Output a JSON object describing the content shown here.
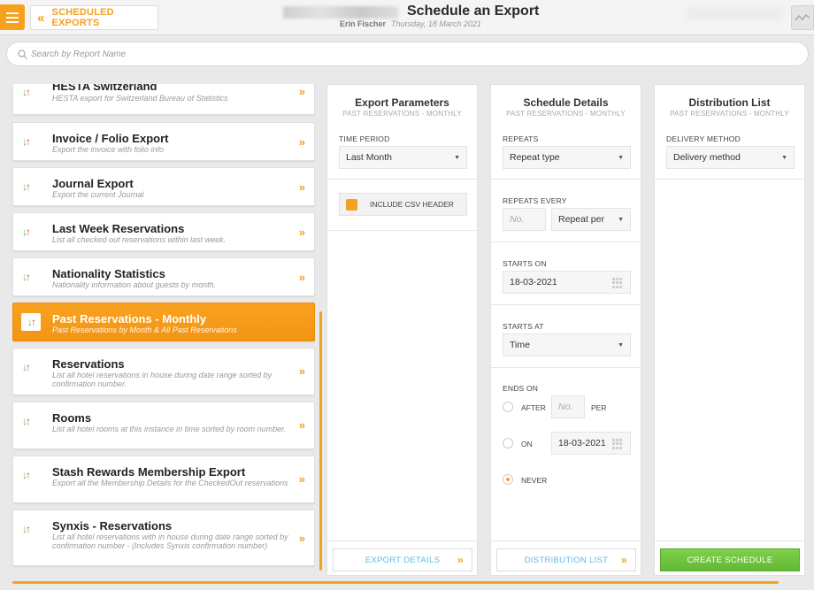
{
  "header": {
    "back_label": "SCHEDULED EXPORTS",
    "title": "Schedule an Export",
    "user": "Erin Fischer",
    "date": "Thursday, 18 March 2021"
  },
  "search": {
    "placeholder": "Search by Report Name"
  },
  "reports": [
    {
      "title": "HESTA Switzerland",
      "desc": "HESTA export for Switzerland Bureau of Statistics"
    },
    {
      "title": "Invoice / Folio Export",
      "desc": "Export the invoice with folio info"
    },
    {
      "title": "Journal Export",
      "desc": "Export the current Journal"
    },
    {
      "title": "Last Week Reservations",
      "desc": "List all checked out reservations within last week."
    },
    {
      "title": "Nationality Statistics",
      "desc": "Nationality information about guests by month."
    },
    {
      "title": "Past Reservations - Monthly",
      "desc": "Past Reservations by Month & All Past Reservations"
    },
    {
      "title": "Reservations",
      "desc": "List all hotel reservations in house during date range sorted by confirmation number."
    },
    {
      "title": "Rooms",
      "desc": "List all hotel rooms at this instance in time sorted by room number."
    },
    {
      "title": "Stash Rewards Membership Export",
      "desc": "Export all the Membership Details for the CheckedOut reservations"
    },
    {
      "title": "Synxis - Reservations",
      "desc": "List all hotel reservations with in house during date range sorted by confirmation number - (Includes Synxis confirmation number)"
    }
  ],
  "export_params": {
    "title": "Export Parameters",
    "subtitle": "PAST RESERVATIONS - MONTHLY",
    "time_period_label": "TIME PERIOD",
    "time_period_value": "Last Month",
    "csv_header_label": "INCLUDE CSV HEADER",
    "button": "EXPORT DETAILS"
  },
  "schedule": {
    "title": "Schedule Details",
    "subtitle": "PAST RESERVATIONS - MONTHLY",
    "repeats_label": "REPEATS",
    "repeats_value": "Repeat type",
    "repeats_every_label": "REPEATS EVERY",
    "repeats_every_placeholder": "No.",
    "repeat_per_value": "Repeat per",
    "starts_on_label": "STARTS ON",
    "starts_on_value": "18-03-2021",
    "starts_at_label": "STARTS AT",
    "starts_at_value": "Time",
    "ends_on_label": "ENDS ON",
    "after_label": "AFTER",
    "after_placeholder": "No.",
    "per_label": "PER",
    "on_label": "ON",
    "on_value": "18-03-2021",
    "never_label": "NEVER",
    "button": "DISTRIBUTION LIST"
  },
  "distribution": {
    "title": "Distribution List",
    "subtitle": "PAST RESERVATIONS - MONTHLY",
    "method_label": "DELIVERY METHOD",
    "method_value": "Delivery method",
    "button": "CREATE SCHEDULE"
  },
  "colors": {
    "accent": "#f7a01d",
    "link": "#5cbde6",
    "create": "#6cc13d"
  }
}
